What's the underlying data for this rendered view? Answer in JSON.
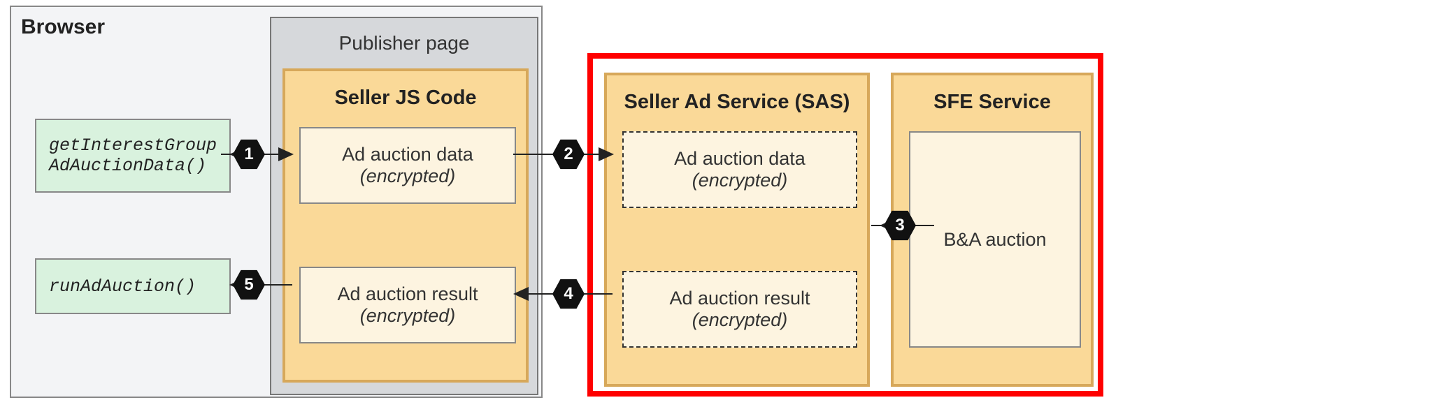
{
  "browser": {
    "label": "Browser",
    "publisher_label": "Publisher page",
    "api1_line1": "getInterestGroup",
    "api1_line2": "AdAuctionData()",
    "api2": "runAdAuction()"
  },
  "seller_js": {
    "title": "Seller JS Code",
    "card1_l1": "Ad auction data",
    "card1_l2": "(encrypted)",
    "card2_l1": "Ad auction result",
    "card2_l2": "(encrypted)"
  },
  "sas": {
    "title": "Seller Ad Service (SAS)",
    "card1_l1": "Ad auction data",
    "card1_l2": "(encrypted)",
    "card2_l1": "Ad auction result",
    "card2_l2": "(encrypted)"
  },
  "sfe": {
    "title": "SFE Service",
    "card_l1": "B&A auction"
  },
  "steps": {
    "s1": "1",
    "s2": "2",
    "s3": "3",
    "s4": "4",
    "s5": "5"
  }
}
